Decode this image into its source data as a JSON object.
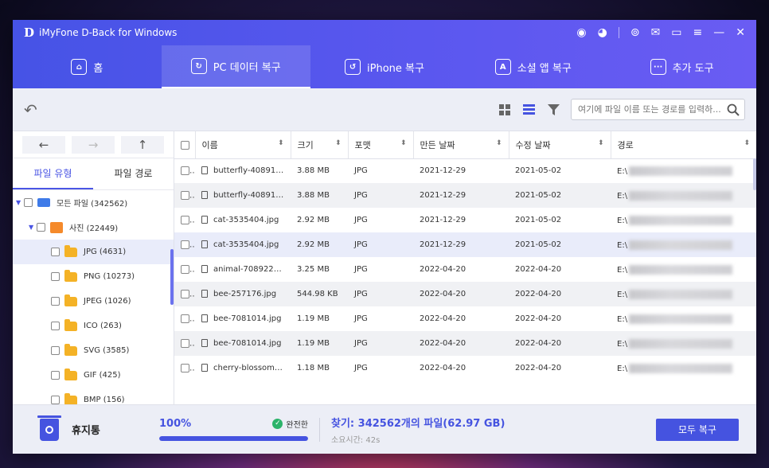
{
  "window": {
    "logo": "D",
    "title": "iMyFone D-Back for Windows"
  },
  "titlebar_icons": [
    "account-icon",
    "discord-icon",
    "settings-icon",
    "mail-icon",
    "chat-icon",
    "menu-icon",
    "minimize-icon",
    "close-icon"
  ],
  "nav_tabs": [
    {
      "label": "홈",
      "icon": "home-icon",
      "active": false
    },
    {
      "label": "PC 데이터 복구",
      "icon": "pc-recovery-icon",
      "active": true
    },
    {
      "label": "iPhone 복구",
      "icon": "iphone-icon",
      "active": false
    },
    {
      "label": "소셜 앱 복구",
      "icon": "social-app-icon",
      "active": false
    },
    {
      "label": "추가 도구",
      "icon": "more-tools-icon",
      "active": false
    }
  ],
  "search": {
    "placeholder": "여기에 파일 이름 또는 경로를 입력하..."
  },
  "sidebar": {
    "tabs": [
      {
        "label": "파일 유형",
        "active": true
      },
      {
        "label": "파일 경로",
        "active": false
      }
    ],
    "tree": [
      {
        "label": "모든 파일 (342562)",
        "level": 0,
        "kind": "drive"
      },
      {
        "label": "사진 (22449)",
        "level": 1,
        "kind": "photo"
      },
      {
        "label": "JPG (4631)",
        "level": 2,
        "kind": "folder",
        "selected": true
      },
      {
        "label": "PNG (10273)",
        "level": 2,
        "kind": "folder"
      },
      {
        "label": "JPEG (1026)",
        "level": 2,
        "kind": "folder"
      },
      {
        "label": "ICO (263)",
        "level": 2,
        "kind": "folder"
      },
      {
        "label": "SVG (3585)",
        "level": 2,
        "kind": "folder"
      },
      {
        "label": "GIF (425)",
        "level": 2,
        "kind": "folder"
      },
      {
        "label": "BMP (156)",
        "level": 2,
        "kind": "folder"
      }
    ]
  },
  "table": {
    "columns": [
      "이름",
      "크기",
      "포맷",
      "만든 날짜",
      "수정 날짜",
      "경로"
    ],
    "rows": [
      {
        "name": "butterfly-408919...",
        "size": "3.88 MB",
        "format": "JPG",
        "created": "2021-12-29",
        "modified": "2021-05-02",
        "path": "E:\\"
      },
      {
        "name": "butterfly-408919...",
        "size": "3.88 MB",
        "format": "JPG",
        "created": "2021-12-29",
        "modified": "2021-05-02",
        "path": "E:\\"
      },
      {
        "name": "cat-3535404.jpg",
        "size": "2.92 MB",
        "format": "JPG",
        "created": "2021-12-29",
        "modified": "2021-05-02",
        "path": "E:\\"
      },
      {
        "name": "cat-3535404.jpg",
        "size": "2.92 MB",
        "format": "JPG",
        "created": "2021-12-29",
        "modified": "2021-05-02",
        "path": "E:\\"
      },
      {
        "name": "animal-7089224.jpg",
        "size": "3.25 MB",
        "format": "JPG",
        "created": "2022-04-20",
        "modified": "2022-04-20",
        "path": "E:\\"
      },
      {
        "name": "bee-257176.jpg",
        "size": "544.98 KB",
        "format": "JPG",
        "created": "2022-04-20",
        "modified": "2022-04-20",
        "path": "E:\\"
      },
      {
        "name": "bee-7081014.jpg",
        "size": "1.19 MB",
        "format": "JPG",
        "created": "2022-04-20",
        "modified": "2022-04-20",
        "path": "E:\\"
      },
      {
        "name": "bee-7081014.jpg",
        "size": "1.19 MB",
        "format": "JPG",
        "created": "2022-04-20",
        "modified": "2022-04-20",
        "path": "E:\\"
      },
      {
        "name": "cherry-blossom-1...",
        "size": "1.18 MB",
        "format": "JPG",
        "created": "2022-04-20",
        "modified": "2022-04-20",
        "path": "E:\\"
      }
    ]
  },
  "footer": {
    "trash_label": "휴지통",
    "progress_percent": "100%",
    "progress_value": 1.0,
    "status_label": "완전한",
    "found_text": "찾기: 342562개의 파일(62.97 GB)",
    "elapsed_text": "소요시간: 42s",
    "recover_button": "모두 복구"
  },
  "colors": {
    "accent": "#4553e0",
    "header_start": "#4653e6",
    "header_end": "#6a5cf3",
    "success": "#2bb36a"
  }
}
